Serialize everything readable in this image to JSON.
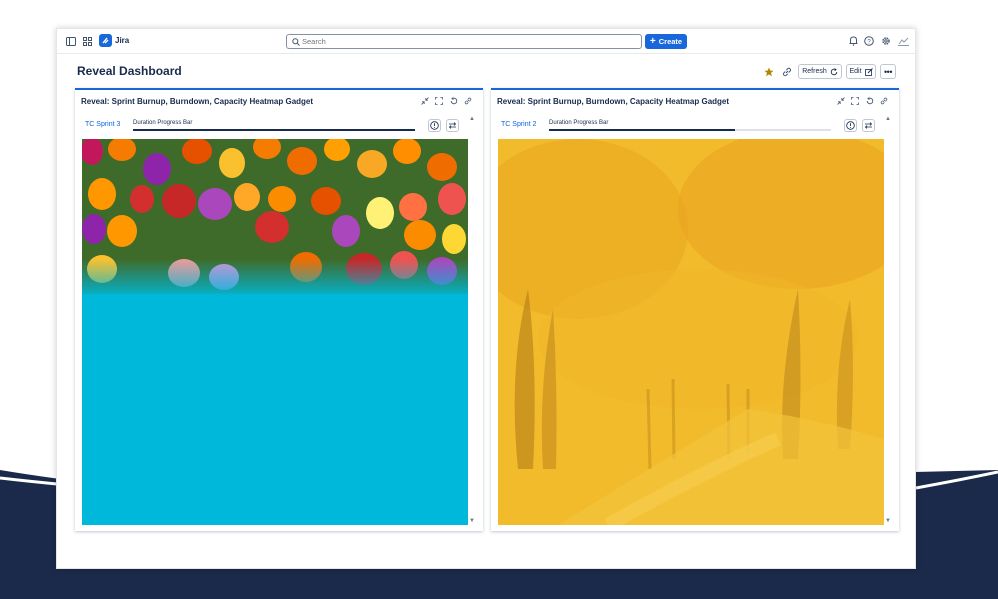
{
  "app": {
    "name": "Jira",
    "brand_color": "#1868db"
  },
  "topnav": {
    "search_placeholder": "Search",
    "create_label": "Create",
    "icons": [
      "sidebar-toggle-icon",
      "app-switcher-icon",
      "bell-icon",
      "help-icon",
      "settings-icon",
      "profile-icon"
    ]
  },
  "page": {
    "title": "Reveal Dashboard",
    "refresh_label": "Refresh",
    "edit_label": "Edit"
  },
  "gadgets": [
    {
      "title": "Reveal: Sprint Burnup, Burndown, Capacity Heatmap Gadget",
      "sprint_label": "TC Sprint 3",
      "progress_label": "Duration Progress Bar",
      "progress_fraction": 1.0,
      "image": "tulip-field-photo"
    },
    {
      "title": "Reveal: Sprint Burnup, Burndown, Capacity Heatmap Gadget",
      "sprint_label": "TC Sprint 2",
      "progress_label": "Duration Progress Bar",
      "progress_fraction": 0.66,
      "image": "autumn-forest-photo"
    }
  ],
  "colors": {
    "accent": "#1868db",
    "background_band": "#1b2a4a",
    "cyan_fill": "#00b8d9",
    "gold_tint": "#f2bb2c"
  }
}
